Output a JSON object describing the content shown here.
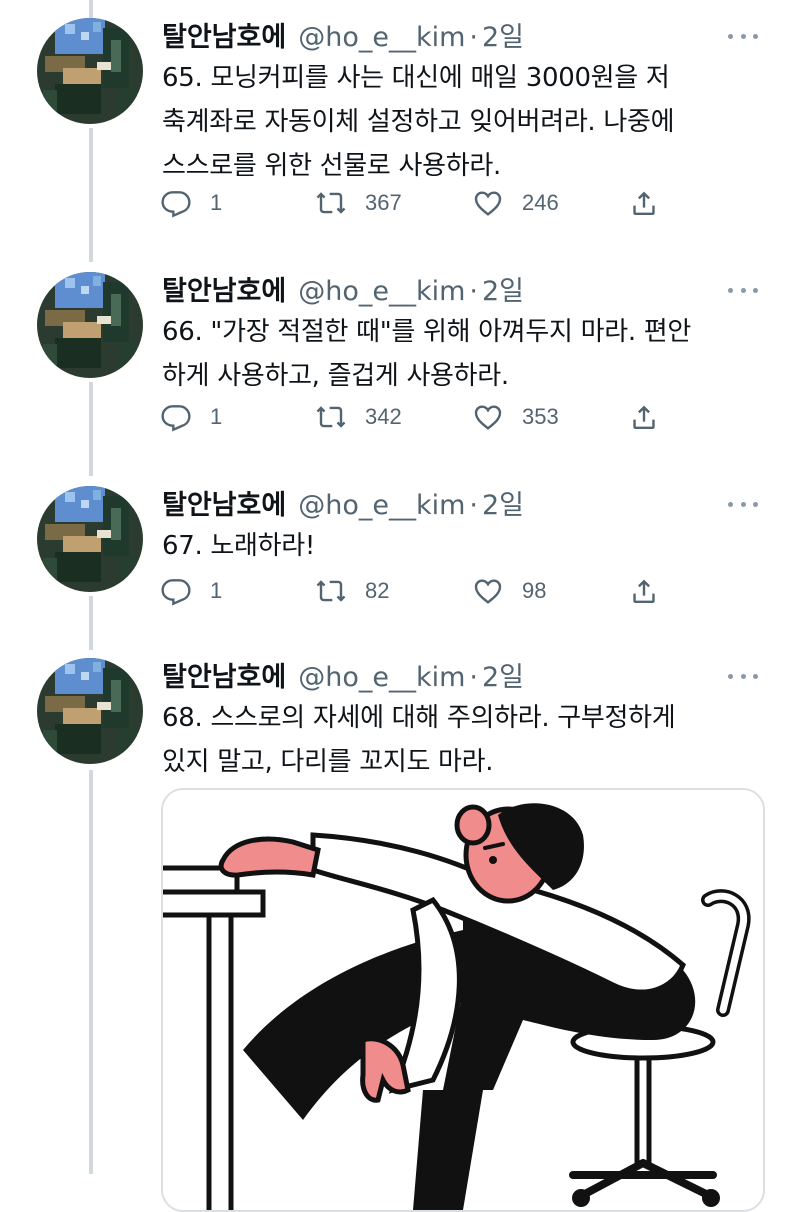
{
  "colors": {
    "text": "#0f1419",
    "secondary": "#536471",
    "thread_line": "#cfd9de",
    "skin": "#f08c8c"
  },
  "icons": {
    "reply": "reply-icon",
    "retweet": "retweet-icon",
    "like": "heart-icon",
    "share": "share-icon",
    "more": "more-icon"
  },
  "tweets": [
    {
      "author": "탈안남호에",
      "handle": "@ho_e__kim",
      "separator": "·",
      "time": "2일",
      "text": "65. 모닝커피를 사는 대신에 매일 3000원을 저\n축계좌로 자동이체 설정하고 잊어버려라. 나중에\n스스로를 위한 선물로 사용하라.",
      "replies": "1",
      "retweets": "367",
      "likes": "246"
    },
    {
      "author": "탈안남호에",
      "handle": "@ho_e__kim",
      "separator": "·",
      "time": "2일",
      "text": "66. \"가장 적절한 때\"를 위해 아껴두지 마라. 편안\n하게 사용하고, 즐겁게 사용하라.",
      "replies": "1",
      "retweets": "342",
      "likes": "353"
    },
    {
      "author": "탈안남호에",
      "handle": "@ho_e__kim",
      "separator": "·",
      "time": "2일",
      "text": "67. 노래하라!",
      "replies": "1",
      "retweets": "82",
      "likes": "98"
    },
    {
      "author": "탈안남호에",
      "handle": "@ho_e__kim",
      "separator": "·",
      "time": "2일",
      "text": "68. 스스로의 자세에 대해 주의하라. 구부정하게\n있지 말고, 다리를 꼬지도 마라."
    }
  ]
}
